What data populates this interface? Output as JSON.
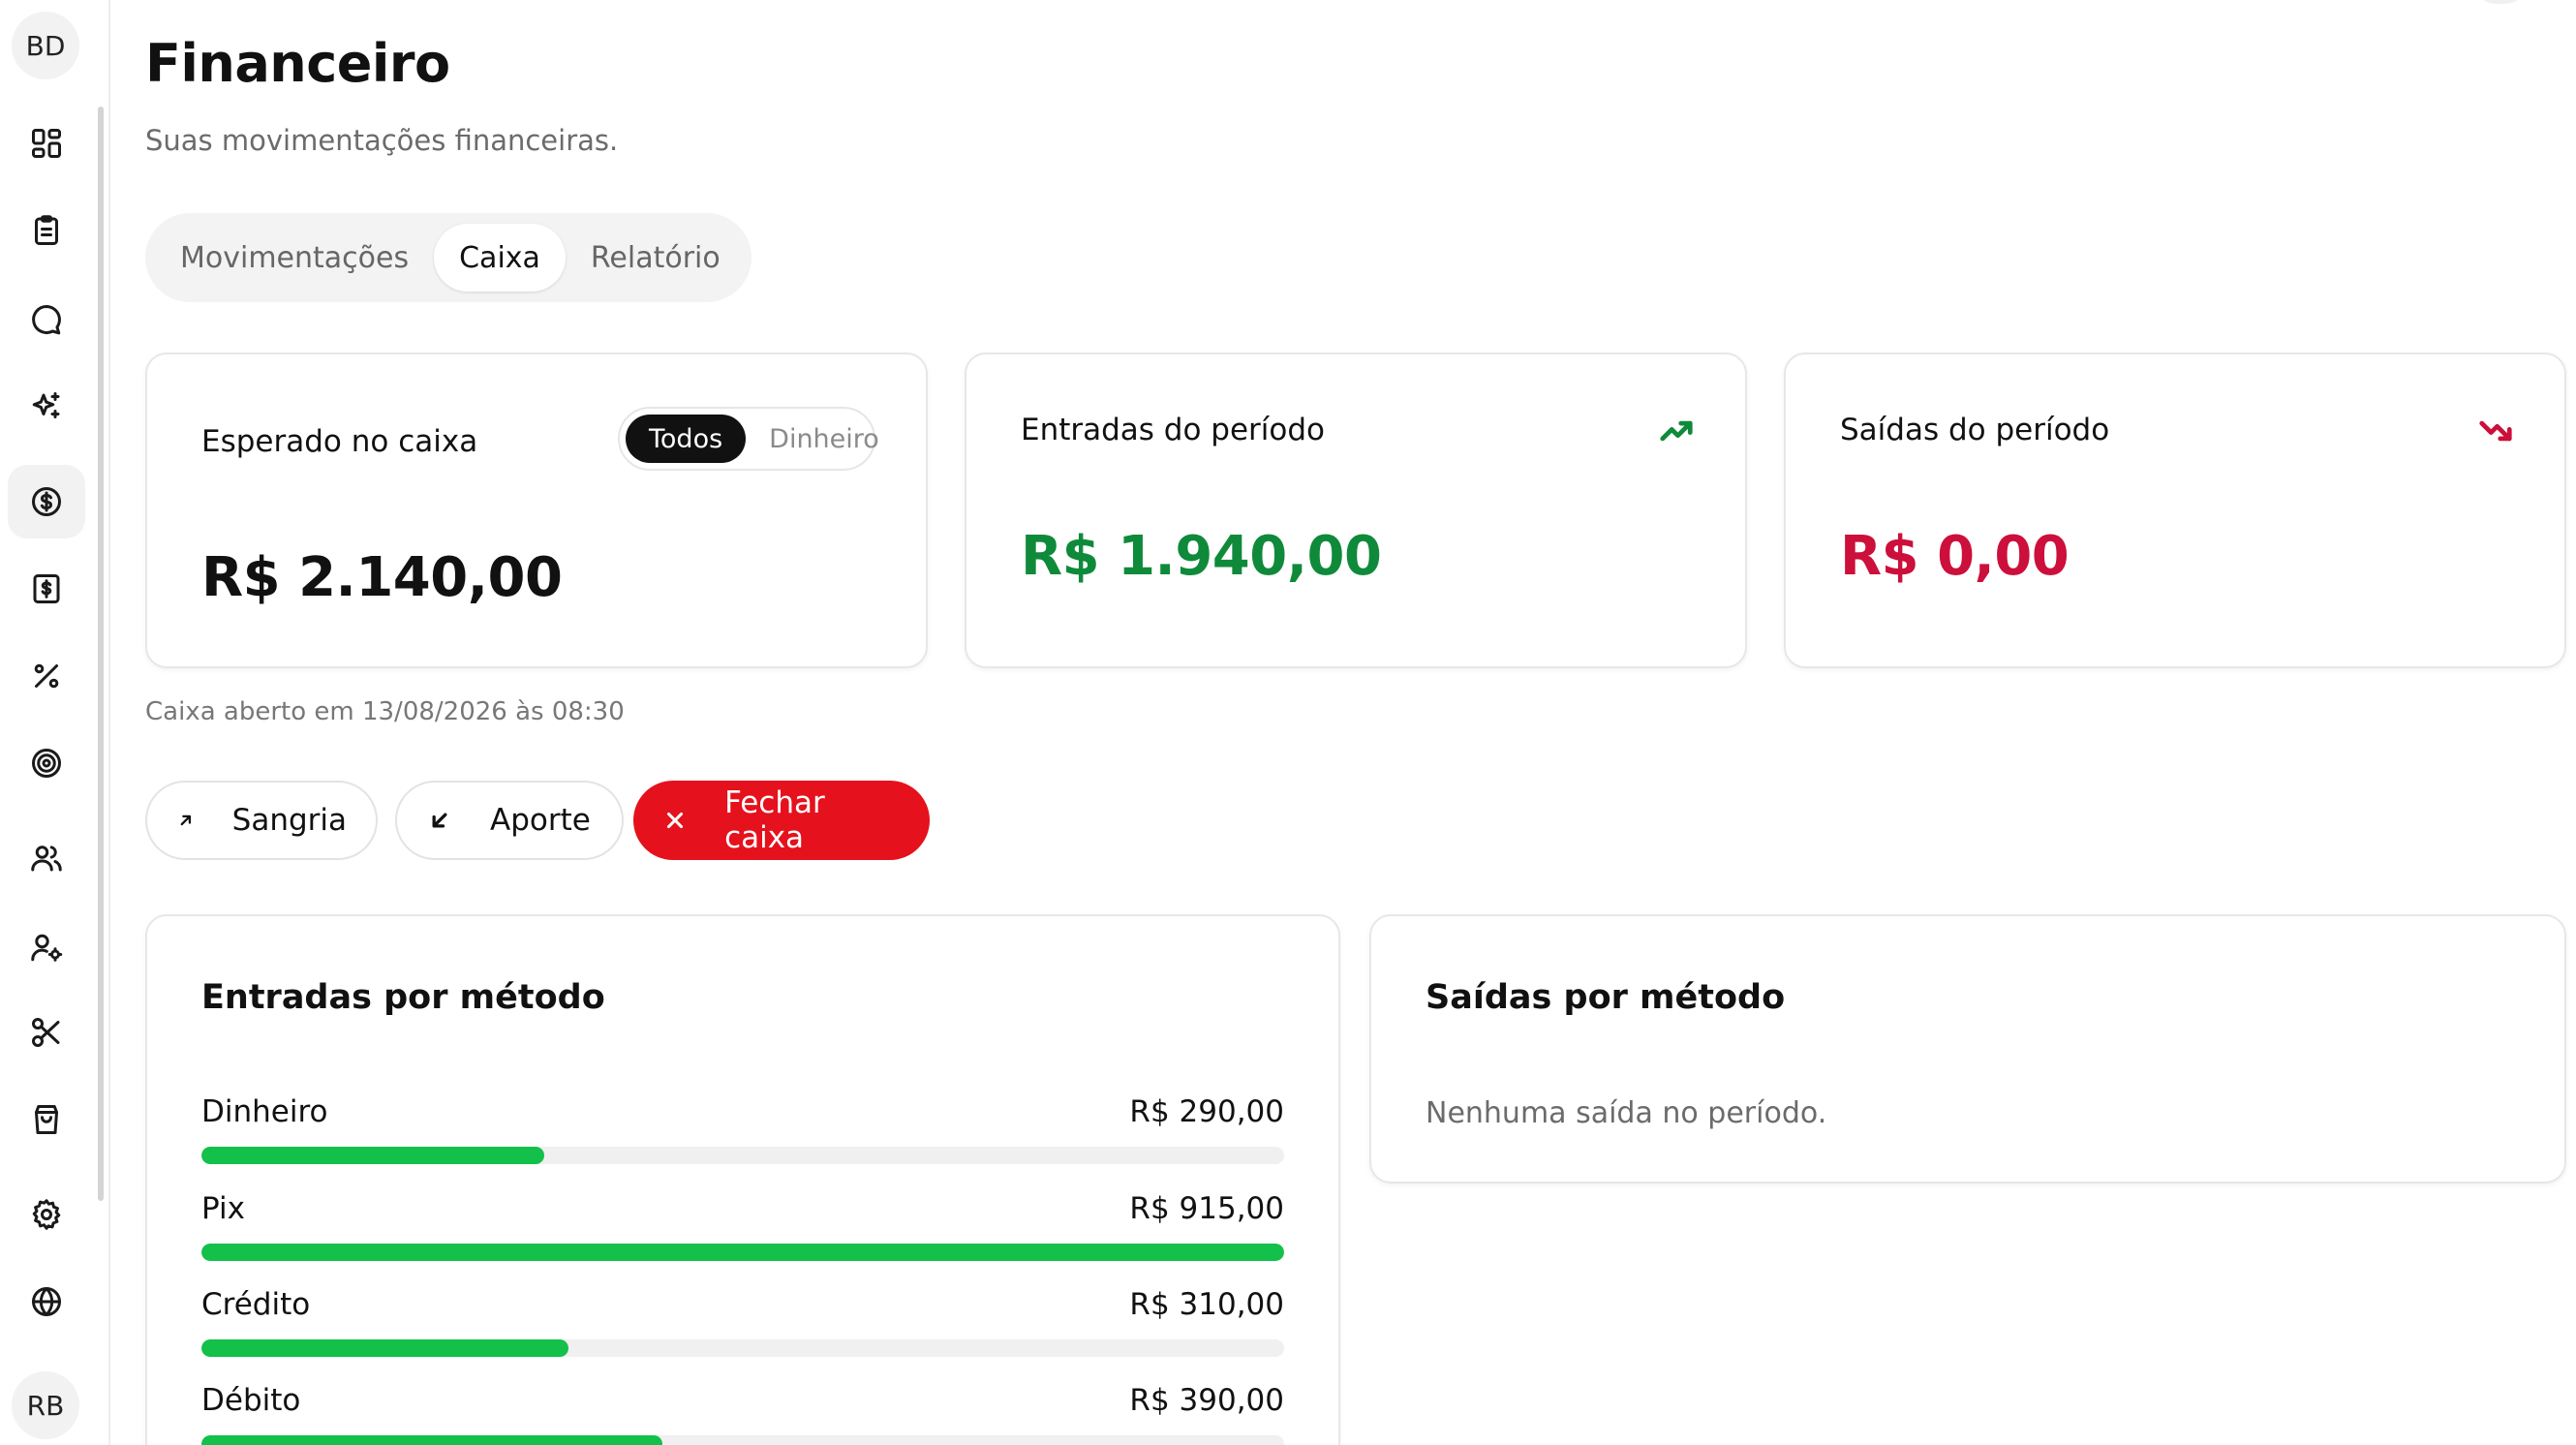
{
  "sidebar": {
    "top_avatar": "BD",
    "bottom_avatar": "RB",
    "items": [
      {
        "icon": "dashboard-icon"
      },
      {
        "icon": "clipboard-icon"
      },
      {
        "icon": "chat-icon"
      },
      {
        "icon": "sparkles-icon"
      },
      {
        "icon": "dollar-circle-icon",
        "active": true
      },
      {
        "icon": "dollar-document-icon"
      },
      {
        "icon": "percent-icon"
      },
      {
        "icon": "target-icon"
      },
      {
        "icon": "users-icon"
      },
      {
        "icon": "user-settings-icon"
      },
      {
        "icon": "scissors-icon"
      },
      {
        "icon": "shopping-bag-icon"
      },
      {
        "icon": "gear-icon"
      },
      {
        "icon": "globe-icon"
      }
    ]
  },
  "header": {
    "title": "Financeiro",
    "subtitle": "Suas movimentações financeiras."
  },
  "tabs": [
    {
      "label": "Movimentações"
    },
    {
      "label": "Caixa",
      "active": true
    },
    {
      "label": "Relatório"
    }
  ],
  "cards": {
    "expected": {
      "label": "Esperado no caixa",
      "value": "R$ 2.140,00",
      "filter_options": [
        "Todos",
        "Dinheiro"
      ],
      "filter_selected": "Todos"
    },
    "income": {
      "label": "Entradas do período",
      "value": "R$ 1.940,00",
      "color": "#0f8a3a",
      "icon": "trending-up-icon"
    },
    "outgoing": {
      "label": "Saídas do período",
      "value": "R$ 0,00",
      "color": "#cc0f3b",
      "icon": "trending-down-icon"
    }
  },
  "cash_note": "Caixa aberto em 13/08/2026 às 08:30",
  "actions": {
    "withdraw": "Sangria",
    "deposit": "Aporte",
    "close": "Fechar caixa"
  },
  "income_by_method": {
    "title": "Entradas por método",
    "items": [
      {
        "name": "Dinheiro",
        "value": "R$ 290,00",
        "share": 0.317
      },
      {
        "name": "Pix",
        "value": "R$ 915,00",
        "share": 1.0
      },
      {
        "name": "Crédito",
        "value": "R$ 310,00",
        "share": 0.339
      },
      {
        "name": "Débito",
        "value": "R$ 390,00",
        "share": 0.426
      }
    ],
    "bar_color": "#12c04a"
  },
  "outgoing_by_method": {
    "title": "Saídas por método",
    "empty_message": "Nenhuma saída no período."
  }
}
